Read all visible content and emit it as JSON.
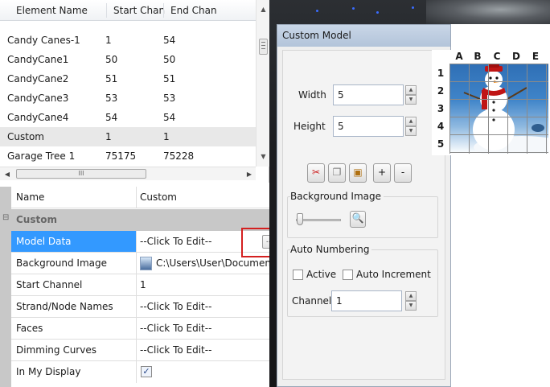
{
  "element_list": {
    "columns": [
      "Element Name",
      "Start Chan",
      "End Chan"
    ],
    "rows": [
      {
        "name": "Candy Canes-1",
        "start": "1",
        "end": "54"
      },
      {
        "name": "CandyCane1",
        "start": "50",
        "end": "50"
      },
      {
        "name": "CandyCane2",
        "start": "51",
        "end": "51"
      },
      {
        "name": "CandyCane3",
        "start": "53",
        "end": "53"
      },
      {
        "name": "CandyCane4",
        "start": "54",
        "end": "54"
      },
      {
        "name": "Custom",
        "start": "1",
        "end": "1"
      },
      {
        "name": "Garage Tree 1",
        "start": "75175",
        "end": "75228"
      }
    ],
    "selected_row": "Custom",
    "hscroll_grip": "III"
  },
  "property_grid": {
    "header": {
      "name": "Name",
      "value": "Custom"
    },
    "category": "Custom",
    "rows": [
      {
        "name": "Model Data",
        "value": "--Click To Edit--"
      },
      {
        "name": "Background Image",
        "value": "C:\\Users\\User\\Documents\\M"
      },
      {
        "name": "Start Channel",
        "value": "1"
      },
      {
        "name": "Strand/Node Names",
        "value": "--Click To Edit--"
      },
      {
        "name": "Faces",
        "value": "--Click To Edit--"
      },
      {
        "name": "Dimming Curves",
        "value": "--Click To Edit--"
      },
      {
        "name": "In My Display",
        "value": ""
      }
    ],
    "ellipsis_label": "...",
    "in_my_display_checked": "✓"
  },
  "dialog": {
    "title": "Custom Model",
    "width_label": "Width",
    "width_value": "5",
    "height_label": "Height",
    "height_value": "5",
    "toolbar": {
      "cut_icon": "cut-icon",
      "copy_icon": "copy-icon",
      "paste_icon": "paste-icon",
      "plus_label": "+",
      "minus_label": "-"
    },
    "background_image_label": "Background Image",
    "auto_numbering_label": "Auto Numbering",
    "active_label": "Active",
    "auto_increment_label": "Auto Increment",
    "channel_label": "Channel",
    "channel_value": "1"
  },
  "grid_preview": {
    "columns": [
      "A",
      "B",
      "C",
      "D",
      "E"
    ],
    "rows": [
      "1",
      "2",
      "3",
      "4",
      "5"
    ]
  },
  "colors": {
    "selection_blue": "#3399ff",
    "highlight_red": "#d42020",
    "dialog_title": "#c9d6e7"
  }
}
